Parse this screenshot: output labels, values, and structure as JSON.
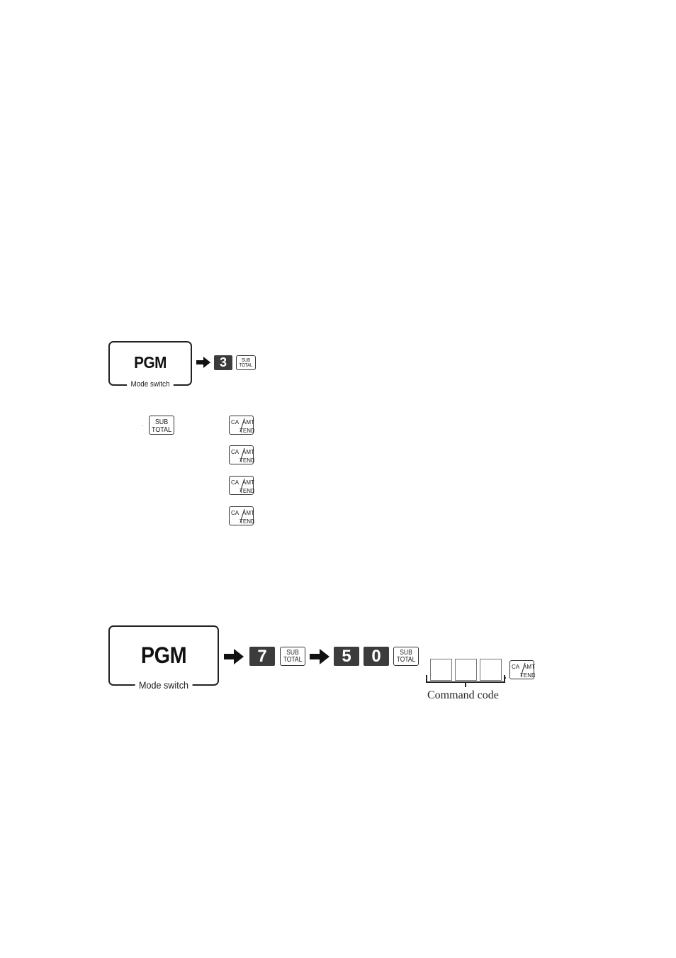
{
  "diagram1": {
    "mode_switch": {
      "label": "PGM",
      "caption": "Mode switch"
    },
    "sequence": [
      {
        "type": "numkey",
        "label": "3"
      },
      {
        "type": "subtotal",
        "line1": "SUB",
        "line2": "TOTAL"
      }
    ]
  },
  "key_list": {
    "subtotal_key": {
      "line1": "SUB",
      "line2": "TOTAL"
    },
    "ca_keys": [
      {
        "top": "CA",
        "mid": "AMT",
        "bottom": "TEND"
      },
      {
        "top": "CA",
        "mid": "AMT",
        "bottom": "TEND"
      },
      {
        "top": "CA",
        "mid": "AMT",
        "bottom": "TEND"
      },
      {
        "top": "CA",
        "mid": "AMT",
        "bottom": "TEND"
      }
    ]
  },
  "diagram2": {
    "mode_switch": {
      "label": "PGM",
      "caption": "Mode switch"
    },
    "sequence": [
      {
        "type": "numkey",
        "label": "7"
      },
      {
        "type": "subtotal",
        "line1": "SUB",
        "line2": "TOTAL"
      },
      {
        "type": "numkey",
        "label": "5"
      },
      {
        "type": "numkey",
        "label": "0"
      },
      {
        "type": "subtotal",
        "line1": "SUB",
        "line2": "TOTAL"
      }
    ],
    "command_code_label": "Command code",
    "command_code_digits": 3,
    "ca_key": {
      "top": "CA",
      "mid": "AMT",
      "bottom": "TEND"
    }
  }
}
